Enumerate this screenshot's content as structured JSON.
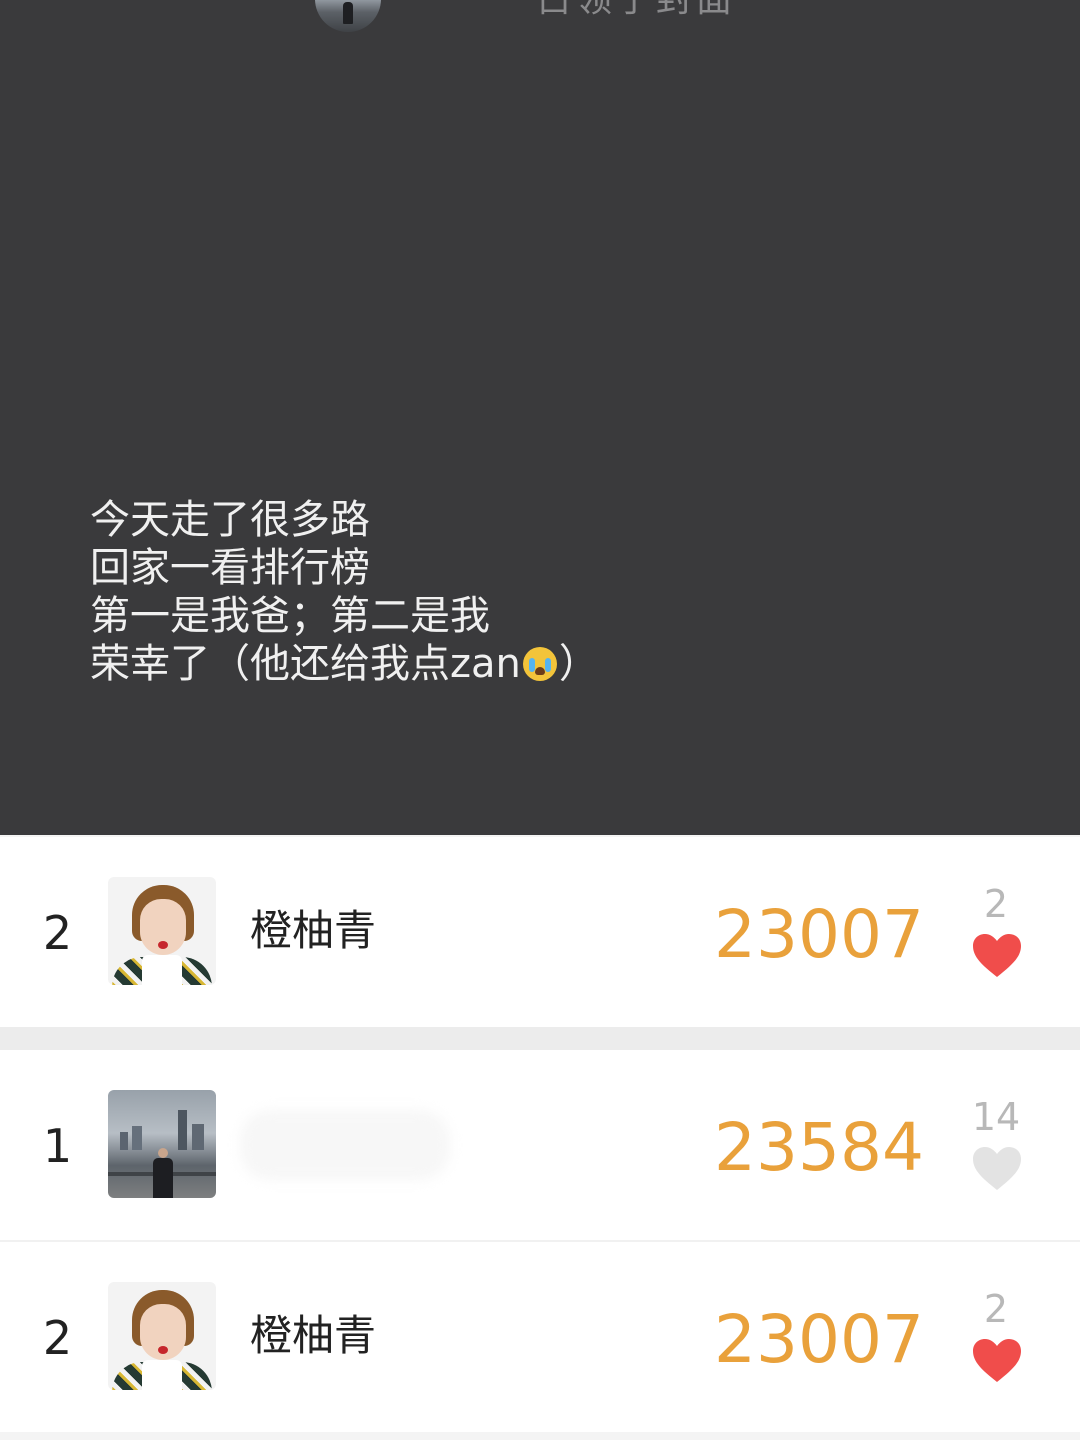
{
  "header": {
    "cover_title": "占领了封面"
  },
  "caption": {
    "lines": [
      "今天走了很多路",
      "回家一看排行榜",
      "第一是我爸；第二是我",
      "荣幸了（他还给我点zan",
      "）"
    ],
    "emoji": "loudly-crying-face-emoji"
  },
  "ranking": [
    {
      "rank": "2",
      "name": "橙柚青",
      "steps": "23007",
      "likes": "2",
      "liked": true,
      "avatar": "girl-avatar"
    },
    {
      "rank": "1",
      "name": "",
      "steps": "23584",
      "likes": "14",
      "liked": false,
      "avatar": "city-avatar"
    },
    {
      "rank": "2",
      "name": "橙柚青",
      "steps": "23007",
      "likes": "2",
      "liked": true,
      "avatar": "girl-avatar"
    }
  ],
  "colors": {
    "cover_bg": "#3a3a3c",
    "steps": "#e9a13b",
    "heart_liked": "#f04d4b",
    "heart_unliked": "#e3e3e3",
    "likes_count": "#b8b8b8"
  }
}
